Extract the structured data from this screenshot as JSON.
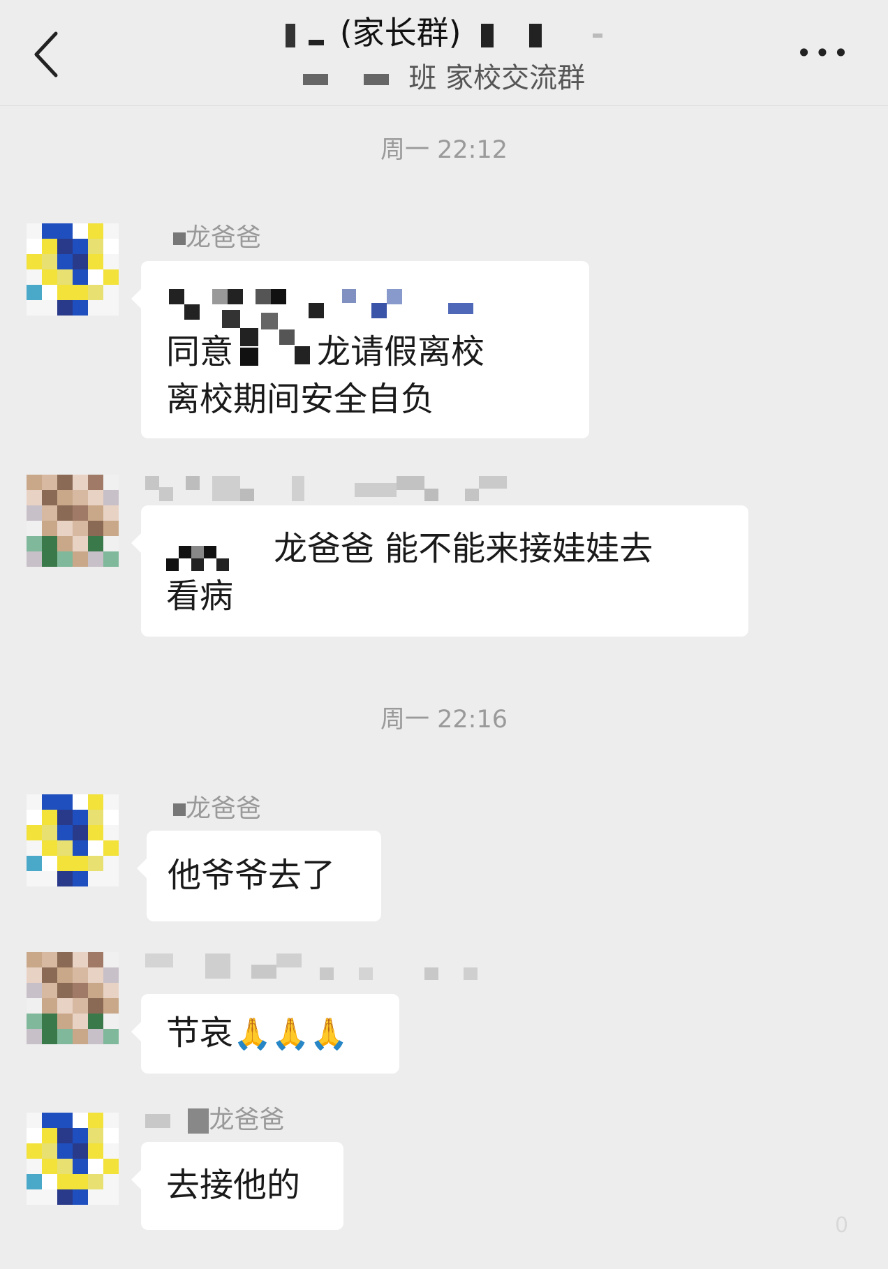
{
  "header": {
    "title_visible": "(家长群)",
    "subtitle_visible": "班 家校交流群",
    "back_icon": "chevron-left-icon",
    "more_icon": "more-horizontal-icon",
    "more_text": "•••"
  },
  "timestamps": [
    "周一 22:12",
    "周一 22:16"
  ],
  "messages": [
    {
      "sender": "龙爸爸",
      "lines": [
        "同意",
        "龙请假离校",
        "离校期间安全自负"
      ]
    },
    {
      "sender": "",
      "lines": [
        "龙爸爸  能不能来接娃娃去",
        "看病"
      ]
    },
    {
      "sender": "龙爸爸",
      "lines": [
        "他爷爷去了"
      ]
    },
    {
      "sender": "",
      "lines": [
        "节哀"
      ],
      "emoji": "🙏🙏🙏"
    },
    {
      "sender": "龙爸爸",
      "lines": [
        "去接他的"
      ]
    }
  ],
  "corner_text": "0",
  "colors": {
    "background": "#ededed",
    "bubble": "#ffffff",
    "timestamp": "#9a9a9a",
    "avatar_blue": "#1f4fbf",
    "avatar_yellow": "#f2e23a"
  }
}
